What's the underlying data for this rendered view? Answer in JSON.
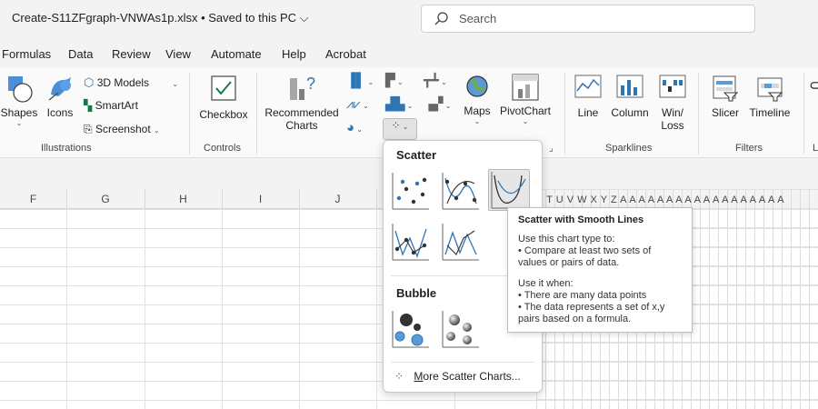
{
  "title_bar": {
    "document_title": "Create-S11ZFgraph-VNWAs1p.xlsx • Saved to this PC ⌵",
    "search_placeholder": "Search"
  },
  "tabs": [
    "Formulas",
    "Data",
    "Review",
    "View",
    "Automate",
    "Help",
    "Acrobat"
  ],
  "ribbon": {
    "illustrations": {
      "shapes": "Shapes",
      "icons": "Icons",
      "models_3d": "3D Models",
      "smartart": "SmartArt",
      "screenshot": "Screenshot",
      "group_label": "Illustrations"
    },
    "controls": {
      "checkbox": "Checkbox",
      "group_label": "Controls"
    },
    "charts": {
      "recommended_line1": "Recommended",
      "recommended_line2": "Charts",
      "maps": "Maps",
      "pivotchart": "PivotChart"
    },
    "sparklines": {
      "line": "Line",
      "column": "Column",
      "winloss_line1": "Win/",
      "winloss_line2": "Loss",
      "group_label": "Sparklines"
    },
    "filters": {
      "slicer": "Slicer",
      "timeline": "Timeline",
      "group_label": "Filters"
    },
    "cut_label": "L"
  },
  "columns": [
    "F",
    "G",
    "H",
    "I",
    "J"
  ],
  "fine_columns": "S T U V W X Y Z A A A A A A A A A A A A A A A A A A",
  "scatter_menu": {
    "scatter_heading": "Scatter",
    "bubble_heading": "Bubble",
    "more_prefix": "M",
    "more_rest": "ore Scatter Charts..."
  },
  "tooltip": {
    "title": "Scatter with Smooth Lines",
    "line1": "Use this chart type to:",
    "line2": "• Compare at least two sets of",
    "line3": "values or pairs of data.",
    "line4": "Use it when:",
    "line5": "• There are many data points",
    "line6": "• The data represents a set of x,y",
    "line7": "pairs based on a formula."
  },
  "colors": {
    "accent_blue": "#2e75b6",
    "excel_green": "#107c41"
  }
}
